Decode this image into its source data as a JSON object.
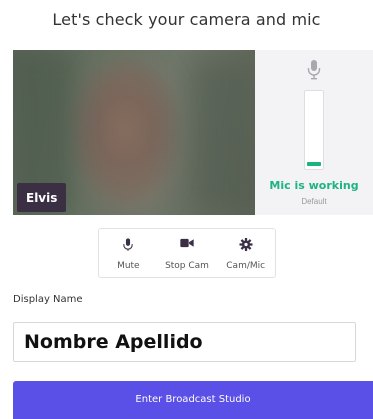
{
  "page": {
    "heading": "Let's check your camera and mic"
  },
  "video": {
    "participant_name": "Elvis"
  },
  "mic": {
    "level": 0.06,
    "status": "Mic is working",
    "device": "Default",
    "icon": "microphone-icon"
  },
  "controls": [
    {
      "label": "Mute",
      "icon": "microphone-icon"
    },
    {
      "label": "Stop Cam",
      "icon": "video-camera-icon"
    },
    {
      "label": "Cam/Mic",
      "icon": "gear-icon"
    }
  ],
  "display_name": {
    "label": "Display Name",
    "value": "Nombre Apellido"
  },
  "enter_button": {
    "label": "Enter Broadcast Studio"
  },
  "colors": {
    "accent": "#5a4fe6",
    "mic_ok": "#19b57a",
    "name_tag_bg": "#3b2f45"
  }
}
